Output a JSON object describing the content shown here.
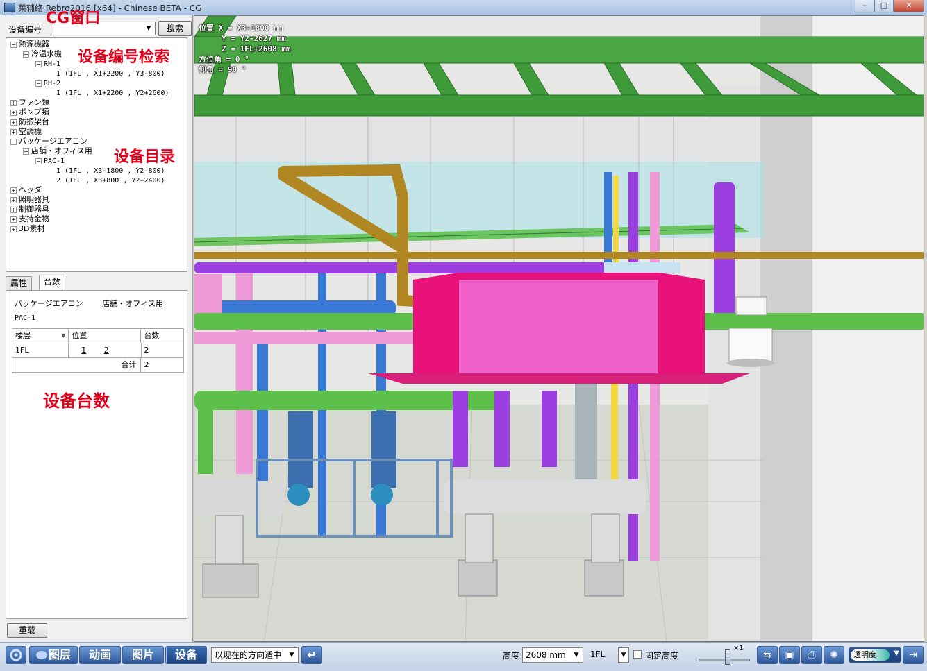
{
  "window": {
    "title": "莱辅络 Rebro2016 [x64] - Chinese BETA - CG",
    "minimize": "–",
    "maximize": "□",
    "close": "✕"
  },
  "annotations": {
    "cg_window": "CG窗口",
    "search_by_id": "设备编号检索",
    "equipment_catalog": "设备目录",
    "equipment_count": "设备台数"
  },
  "search": {
    "label": "设备编号",
    "value": "",
    "button": "搜索"
  },
  "tree": [
    {
      "toggle": "−",
      "indent": 0,
      "text": "熱源機器",
      "mono": false
    },
    {
      "toggle": "−",
      "indent": 1,
      "text": "冷温水機",
      "mono": false
    },
    {
      "toggle": "−",
      "indent": 2,
      "text": "RH-1",
      "mono": true
    },
    {
      "toggle": "",
      "indent": 3,
      "text": "1 (1FL , X1+2200 , Y3-800)",
      "mono": true
    },
    {
      "toggle": "−",
      "indent": 2,
      "text": "RH-2",
      "mono": true
    },
    {
      "toggle": "",
      "indent": 3,
      "text": "1 (1FL , X1+2200 , Y2+2600)",
      "mono": true
    },
    {
      "toggle": "+",
      "indent": 0,
      "text": "ファン類",
      "mono": false
    },
    {
      "toggle": "+",
      "indent": 0,
      "text": "ポンプ類",
      "mono": false
    },
    {
      "toggle": "+",
      "indent": 0,
      "text": "防振架台",
      "mono": false
    },
    {
      "toggle": "+",
      "indent": 0,
      "text": "空調機",
      "mono": false
    },
    {
      "toggle": "−",
      "indent": 0,
      "text": "パッケージエアコン",
      "mono": false
    },
    {
      "toggle": "−",
      "indent": 1,
      "text": "店舗・オフィス用",
      "mono": false
    },
    {
      "toggle": "−",
      "indent": 2,
      "text": "PAC-1",
      "mono": true
    },
    {
      "toggle": "",
      "indent": 3,
      "text": "1 (1FL , X3-1800 , Y2-800)",
      "mono": true
    },
    {
      "toggle": "",
      "indent": 3,
      "text": "2 (1FL , X3+800 , Y2+2400)",
      "mono": true
    },
    {
      "toggle": "+",
      "indent": 0,
      "text": "ヘッダ",
      "mono": false
    },
    {
      "toggle": "+",
      "indent": 0,
      "text": "照明器具",
      "mono": false
    },
    {
      "toggle": "+",
      "indent": 0,
      "text": "制御器具",
      "mono": false
    },
    {
      "toggle": "+",
      "indent": 0,
      "text": "支持金物",
      "mono": false
    },
    {
      "toggle": "+",
      "indent": 0,
      "text": "3D素材",
      "mono": false
    }
  ],
  "tabs": {
    "properties": "属性",
    "count": "台数"
  },
  "count_panel": {
    "category": "パッケージエアコン",
    "subcategory": "店舗・オフィス用",
    "model": "PAC-1",
    "headers": {
      "floor": "楼层",
      "position": "位置",
      "count": "台数"
    },
    "rows": [
      {
        "floor": "1FL",
        "pos1": "1",
        "pos2": "2",
        "count": "2"
      }
    ],
    "total_label": "合计",
    "total": "2"
  },
  "reload": "重载",
  "viewport": {
    "coords": [
      "位置 X = X3-1800 mm",
      "     Y = Y2-2627 mm",
      "     Z = 1FL+2608 mm",
      "方位角 = 0 °",
      "仰角 = 90 °"
    ]
  },
  "toolbar": {
    "layers": "图层",
    "animation": "动画",
    "picture": "图片",
    "equipment": "设备",
    "direction": "以现在的方向适中",
    "height_label": "高度",
    "height_value": "2608 mm",
    "floor": "1FL",
    "fixed_height": "固定高度",
    "zoom_label": "×1",
    "transparency": "透明度"
  },
  "colors": {
    "steel": "#3f9a3a",
    "magenta_unit": "#e8127a",
    "green_pipe": "#5cc04b",
    "blue_pipe": "#3a78d6",
    "purple_pipe": "#9b3fe0",
    "brown_pipe": "#b08722",
    "pink_pipe": "#ee9ad6",
    "light_blue_pipe": "#7fd0e8"
  }
}
